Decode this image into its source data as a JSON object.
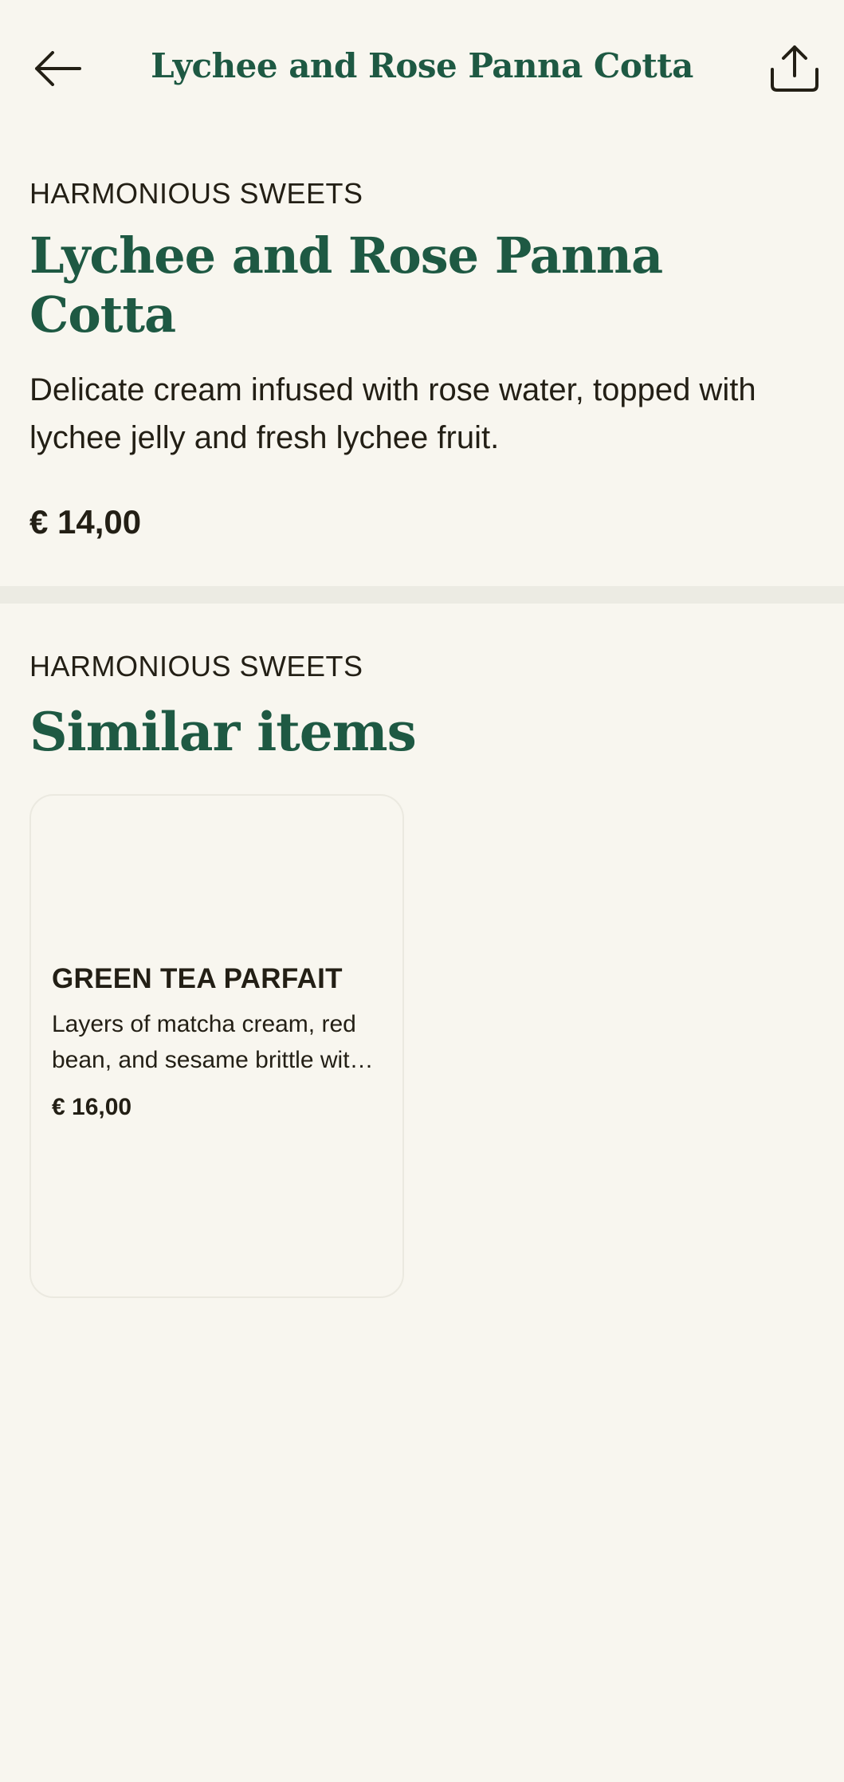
{
  "header": {
    "title": "Lychee and Rose Panna Cotta",
    "back_icon": "arrow-left-icon",
    "share_icon": "share-icon"
  },
  "item": {
    "category": "HARMONIOUS SWEETS",
    "name": "Lychee and Rose Panna Cotta",
    "description": "Delicate cream infused with rose water, topped with lychee jelly and fresh lychee fruit.",
    "price": "€ 14,00"
  },
  "similar": {
    "category": "HARMONIOUS SWEETS",
    "title": "Similar items",
    "items": [
      {
        "name": "GREEN TEA PARFAIT",
        "description": "Layers of matcha cream, red bean, and sesame brittle with green tea ice cream.",
        "price": "€ 16,00"
      }
    ]
  },
  "colors": {
    "background": "#f8f6ef",
    "accent": "#1e5943",
    "text": "#231f15",
    "divider": "#ecebe3"
  }
}
